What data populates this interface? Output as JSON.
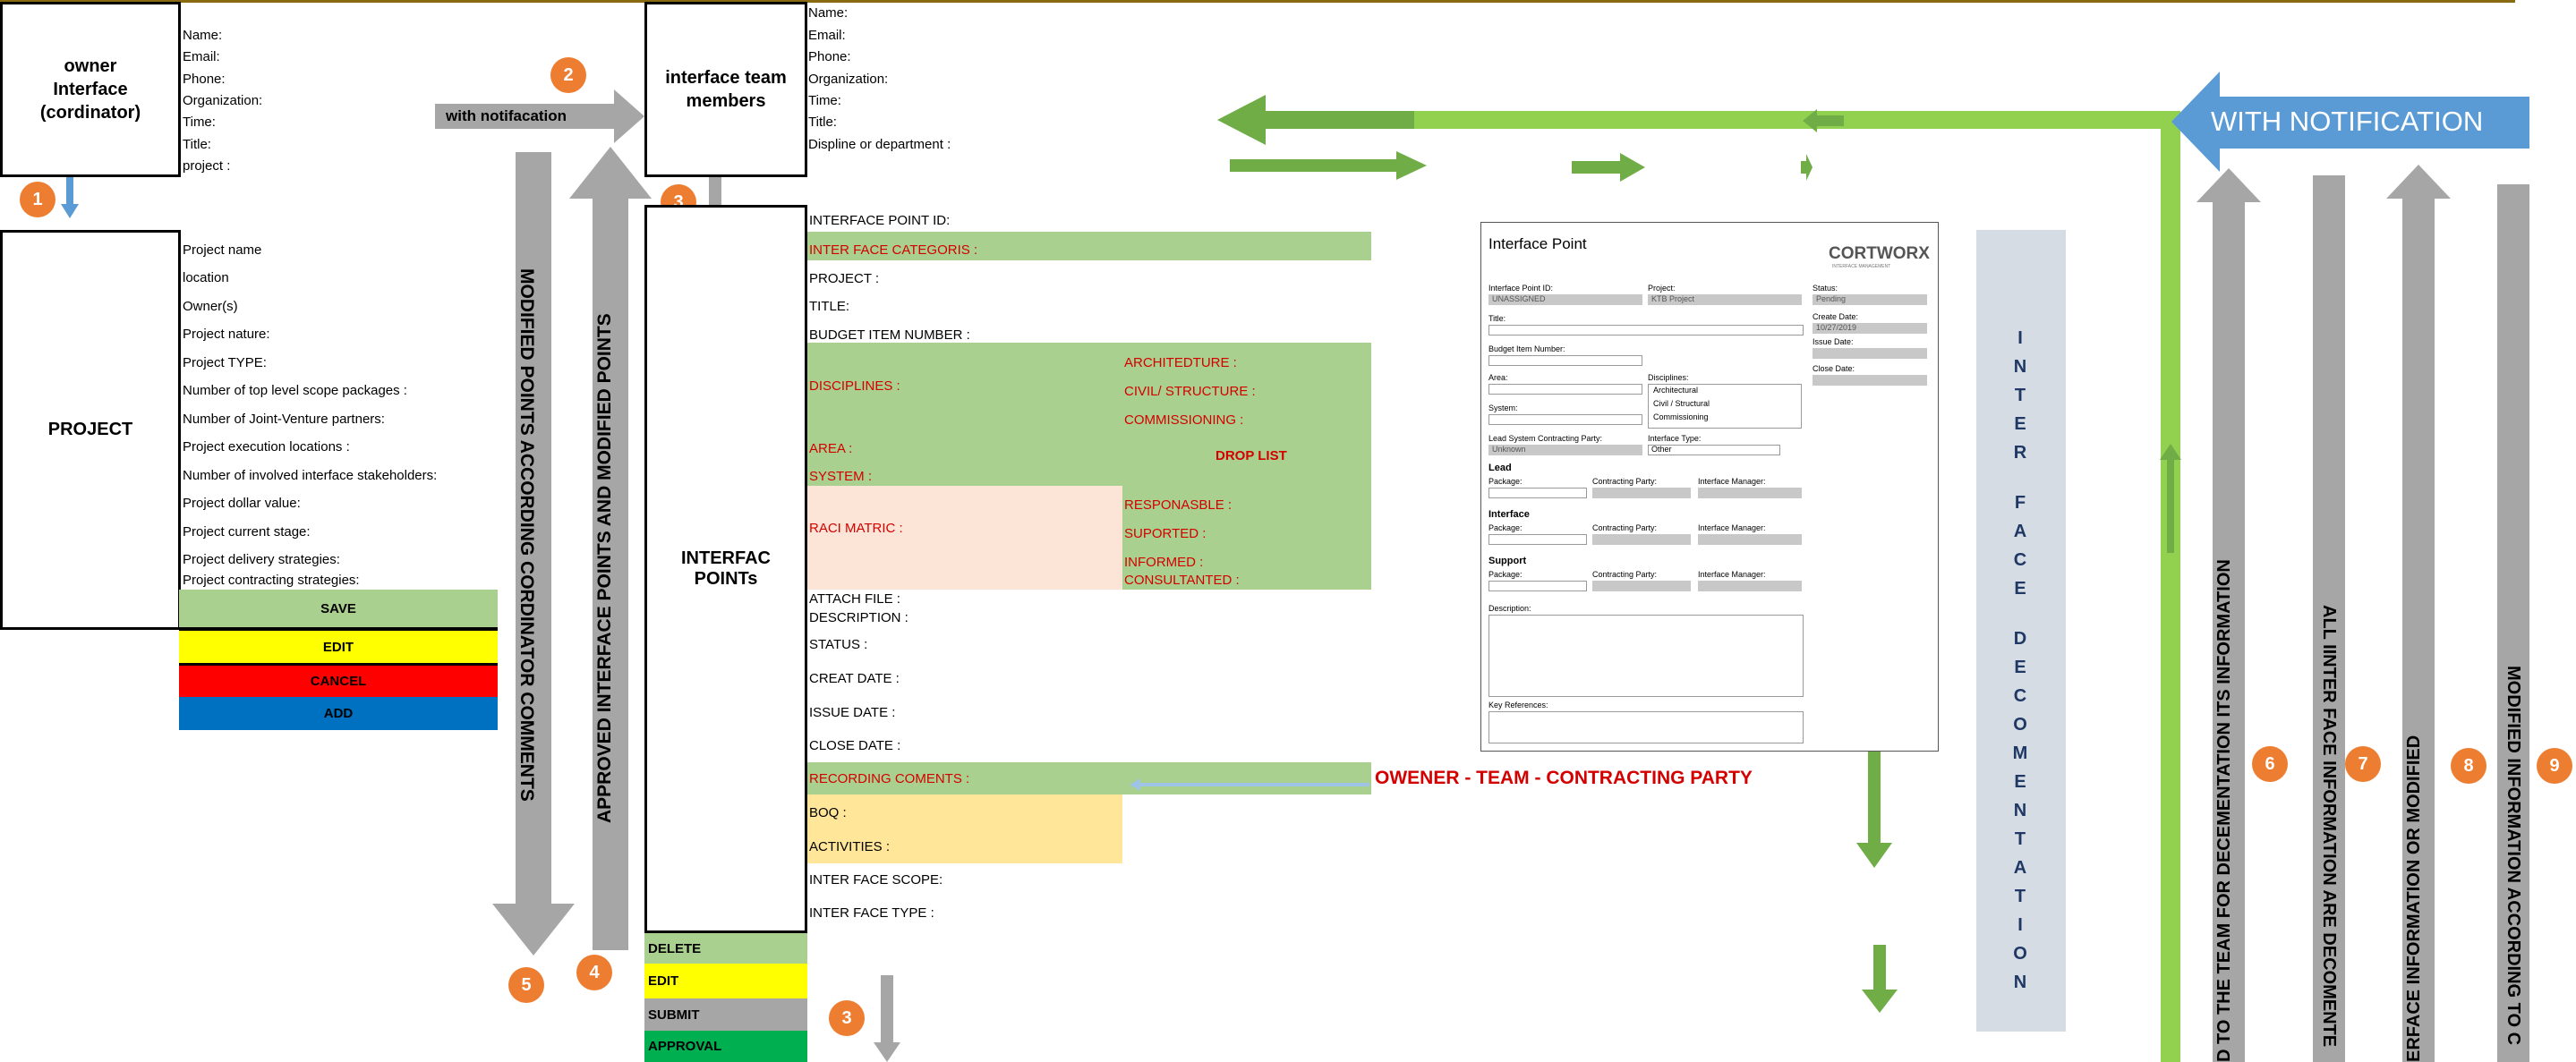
{
  "owner_box": {
    "line1": "owner",
    "line2": "Interface",
    "line3": "(cordinator)"
  },
  "owner_fields": [
    "Name:",
    "Email:",
    "Phone:",
    "Organization:",
    "Time:",
    "Title:",
    "project  :"
  ],
  "project_box": {
    "title": "PROJECT"
  },
  "project_fields": [
    "Project name",
    "location",
    "Owner(s)",
    "Project nature:",
    "Project TYPE:",
    " Number of top level scope packages :",
    "Number of Joint-Venture partners:",
    "Project execution locations :",
    "Number of involved interface stakeholders:",
    "Project dollar value:",
    "Project current stage:",
    "Project delivery strategies:",
    "Project contracting strategies:"
  ],
  "project_buttons": {
    "save": "SAVE",
    "edit": "EDIT",
    "cancel": "CANCEL",
    "add": "ADD"
  },
  "notification_arrow": "with notifacation",
  "team_box": {
    "line1": "interface team",
    "line2": "members"
  },
  "team_fields": [
    "Name:",
    "Email:",
    "Phone:",
    "Organization:",
    "Time:",
    "Title:",
    "Displine or department  :"
  ],
  "vertical_labels": {
    "modified_points": "MODIFIED POINTS ACCORDING CORDINATOR COMMENTS",
    "approved_points": "APPROVED INTERFACE POINTS  AND MODIFIED POINTS",
    "label6": "D TO THE TEAM FOR DECEMENTATION  ITS INFORMATION",
    "label7": "ALL IINTER FACE  INFORMATION  ARE DECOMENTE",
    "label8": "ERFACE INFORMATION OR MODIFIED",
    "label9": "MODIFIED INFORMATION ACCORDING TO C"
  },
  "circles": [
    "1",
    "2",
    "3",
    "3",
    "4",
    "5",
    "6",
    "7",
    "8",
    "9"
  ],
  "points_box": {
    "title": "INTERFAC POINTs"
  },
  "points_fields": {
    "id": "INTERFACE POINT ID:",
    "categories": " INTER FACE CATEGORIS :",
    "project": "PROJECT :",
    "title": "TITLE:",
    "budget": "BUDGET ITEM NUMBER :",
    "disciplines": "DISCIPLINES :",
    "architecture": "ARCHITEDTURE :",
    "civil": "CIVIL/ STRUCTURE :",
    "commissioning": "COMMISSIONING :",
    "area": "AREA :",
    "drop_list": "DROP LIST",
    "system": "SYSTEM :",
    "raci": "RACI MATRIC :",
    "responsible": "RESPONASBLE :",
    "supported": "SUPORTED :",
    "informed": "INFORMED :",
    "consulted": "CONSULTANTED :",
    "attach": "ATTACH FILE :",
    "description": "DESCRIPTION :",
    "status": "STATUS :",
    "create_date": "CREAT DATE :",
    "issue_date": "ISSUE DATE :",
    "close_date": "CLOSE DATE :",
    "recording": "RECORDING COMENTS :",
    "boq": "BOQ :",
    "activities": "ACTIVITIES :",
    "scope": "INTER FACE SCOPE:",
    "type": "INTER FACE TYPE :"
  },
  "owner_team_contracting": "OWENER  - TEAM - CONTRACTING PARTY",
  "points_buttons": {
    "delete": "DELETE",
    "edit": "EDIT",
    "submit": "SUBMIT",
    "approval": "APPROVAL"
  },
  "with_notification": "WITH NOTIFICATION",
  "interface_documentation": [
    "I",
    "N",
    "T",
    "E",
    "R",
    "",
    "F",
    "A",
    "C",
    "E",
    "",
    "D",
    "E",
    "C",
    "O",
    "M",
    "E",
    "N",
    "T",
    "A",
    "T",
    "I",
    "O",
    "N"
  ],
  "form_mock": {
    "title": "Interface Point",
    "logo": "CORTWORX",
    "logo_sub": "INTERFACE MANAGEMENT",
    "interface_point_id_label": "Interface Point ID:",
    "interface_point_id_value": "UNASSIGNED",
    "project_label": "Project:",
    "project_value": "KTB Project",
    "status_label": "Status:",
    "status_value": "Pending",
    "title_label": "Title:",
    "create_date_label": "Create Date:",
    "create_date_value": "10/27/2019",
    "issue_date_label": "Issue Date:",
    "budget_label": "Budget Item Number:",
    "close_date_label": "Close Date:",
    "area_label": "Area:",
    "disciplines_label": "Disciplines:",
    "discipline_options": [
      "Architectural",
      "Civil / Structural",
      "Commissioning"
    ],
    "system_label": "System:",
    "lead_party_label": "Lead System Contracting Party:",
    "lead_party_value": "Unknown",
    "interface_type_label": "Interface Type:",
    "interface_type_value": "Other",
    "section_lead": "Lead",
    "section_interface": "Interface",
    "section_support": "Support",
    "package_label": "Package:",
    "contracting_party_label": "Contracting Party:",
    "interface_manager_label": "Interface Manager:",
    "description_label": "Description:",
    "key_references_label": "Key References:"
  },
  "colors": {
    "green_light": "#a9d08e",
    "green_arrow": "#70ad47",
    "green_bright": "#92d050",
    "yellow": "#ffff00",
    "red": "#ff0000",
    "blue": "#0070c0",
    "gray_arrow": "#a6a6a6",
    "orange": "#ed7d31",
    "salmon": "#fce4d6",
    "tan": "#ffe699",
    "approval_green": "#00b050",
    "blue_notification": "#5b9bd5",
    "doc_panel": "#d6dce4"
  }
}
